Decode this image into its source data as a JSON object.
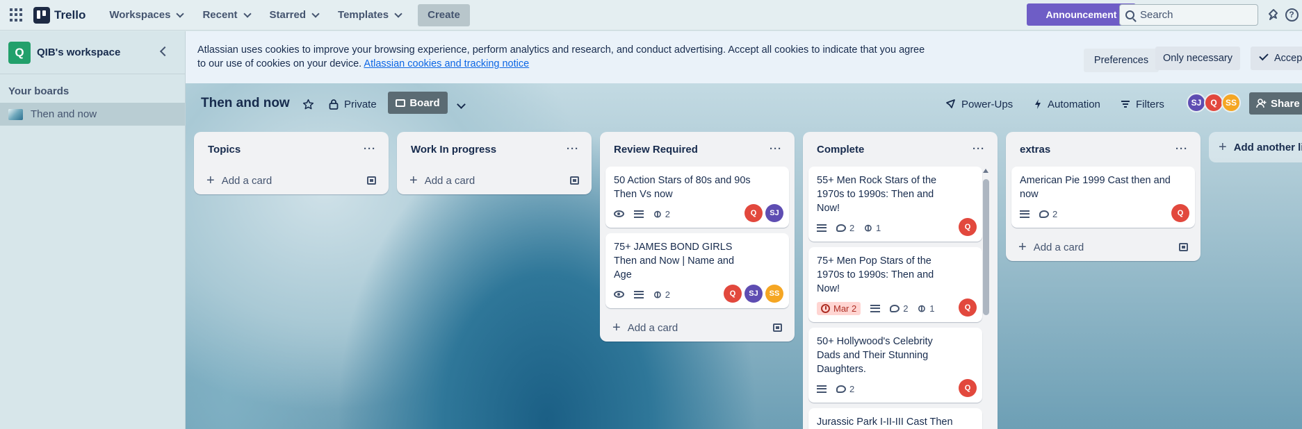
{
  "topbar": {
    "brand": "Trello",
    "nav": [
      "Workspaces",
      "Recent",
      "Starred",
      "Templates"
    ],
    "create": "Create",
    "announcement": "Announcement",
    "search_placeholder": "Search"
  },
  "sidebar": {
    "workspace_initial": "Q",
    "workspace_name": "QIB's workspace",
    "section_title": "Your boards",
    "boards": [
      "Then and now"
    ]
  },
  "cookie_banner": {
    "text": "Atlassian uses cookies to improve your browsing experience, perform analytics and research, and conduct advertising. Accept all cookies to indicate that you agree to our use of cookies on your device.",
    "link": "Atlassian cookies and tracking notice",
    "preferences": "Preferences",
    "only_necessary": "Only necessary",
    "accept_all": "Accept"
  },
  "board": {
    "title": "Then and now",
    "visibility": "Private",
    "view": "Board",
    "power_ups": "Power-Ups",
    "automation": "Automation",
    "filters": "Filters",
    "share": "Share",
    "members": [
      {
        "initials": "SJ",
        "color": "#5e4db2"
      },
      {
        "initials": "Q",
        "color": "#e2483d"
      },
      {
        "initials": "SS",
        "color": "#f5a623"
      }
    ]
  },
  "colors": {
    "sj": "#5e4db2",
    "q": "#e2483d",
    "ss": "#f5a623",
    "announcement": "#6e5dc6",
    "workspace": "#22a06b"
  },
  "add_card_label": "Add a card",
  "add_list_label": "Add another list",
  "lists": [
    {
      "title": "Topics",
      "cards": []
    },
    {
      "title": "Work In progress",
      "cards": []
    },
    {
      "title": "Review Required",
      "cards": [
        {
          "title": "50 Action Stars of 80s and 90s Then Vs now",
          "attachments": "2",
          "members": [
            "Q",
            "SJ"
          ]
        },
        {
          "title": "75+ JAMES BOND GIRLS Then and Now | Name and Age",
          "attachments": "2",
          "members": [
            "Q",
            "SJ",
            "SS"
          ]
        }
      ]
    },
    {
      "title": "Complete",
      "cards": [
        {
          "title": "55+ Men Rock Stars of the 1970s to 1990s: Then and Now!",
          "comments": "2",
          "attachments": "1",
          "members": [
            "Q"
          ]
        },
        {
          "title": "75+ Men Pop Stars of the 1970s to 1990s: Then and Now!",
          "due": "Mar 2",
          "comments": "2",
          "attachments": "1",
          "members": [
            "Q"
          ]
        },
        {
          "title": "50+ Hollywood's Celebrity Dads and Their Stunning Daughters.",
          "comments": "2",
          "members": [
            "Q"
          ]
        },
        {
          "title": "Jurassic Park I-II-III Cast Then"
        }
      ]
    },
    {
      "title": "extras",
      "cards": [
        {
          "title": "American Pie 1999 Cast then and now",
          "comments": "2",
          "members": [
            "Q"
          ]
        }
      ]
    }
  ]
}
